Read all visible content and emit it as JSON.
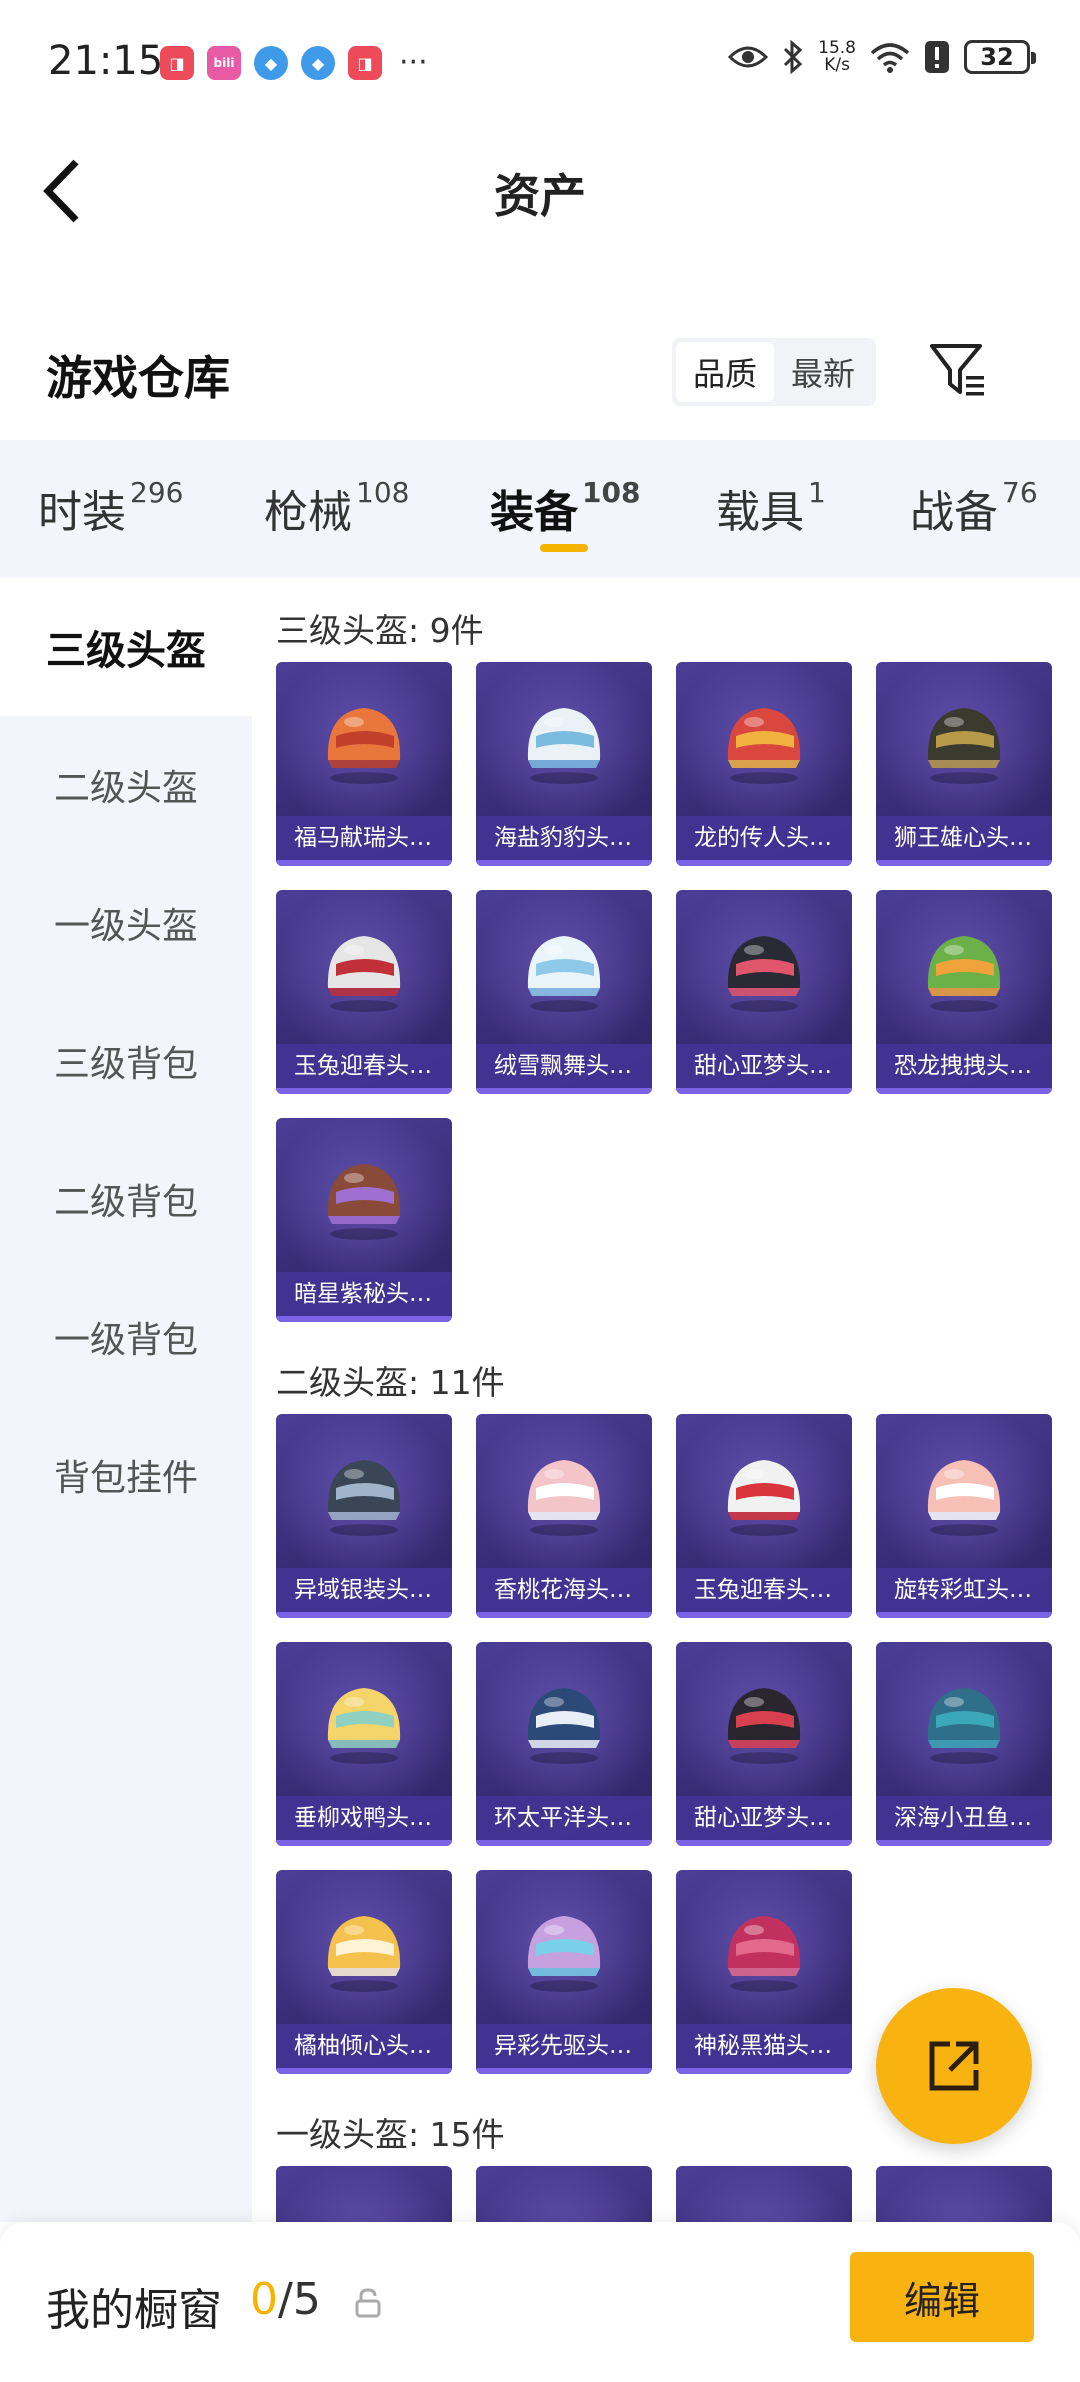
{
  "status": {
    "time": "21:15",
    "speed_top": "15.8",
    "speed_unit": "K/s",
    "battery": "32"
  },
  "nav": {
    "title": "资产"
  },
  "warehouse": {
    "title": "游戏仓库",
    "sort_options": [
      "品质",
      "最新"
    ]
  },
  "tabs": [
    {
      "label": "时装",
      "count": "296"
    },
    {
      "label": "枪械",
      "count": "108"
    },
    {
      "label": "装备",
      "count": "108"
    },
    {
      "label": "载具",
      "count": "1"
    },
    {
      "label": "战备",
      "count": "76"
    }
  ],
  "sidebar": [
    "三级头盔",
    "二级头盔",
    "一级头盔",
    "三级背包",
    "二级背包",
    "一级背包",
    "背包挂件"
  ],
  "sections": [
    {
      "title": "三级头盔: 9件",
      "items": [
        "福马献瑞头…",
        "海盐豹豹头…",
        "龙的传人头…",
        "狮王雄心头…",
        "玉兔迎春头…",
        "绒雪飘舞头…",
        "甜心亚梦头…",
        "恐龙拽拽头…",
        "暗星紫秘头…"
      ]
    },
    {
      "title": "二级头盔: 11件",
      "items": [
        "异域银装头…",
        "香桃花海头…",
        "玉兔迎春头…",
        "旋转彩虹头…",
        "垂柳戏鸭头…",
        "环太平洋头…",
        "甜心亚梦头…",
        "深海小丑鱼…",
        "橘柚倾心头…",
        "异彩先驱头…",
        "神秘黑猫头…"
      ]
    },
    {
      "title": "一级头盔: 15件",
      "items": []
    }
  ],
  "bottom": {
    "label": "我的橱窗",
    "current": "0",
    "total": "/5",
    "edit": "编辑"
  },
  "colors": {
    "accent": "#f8b310",
    "card": "#3a2d78"
  }
}
